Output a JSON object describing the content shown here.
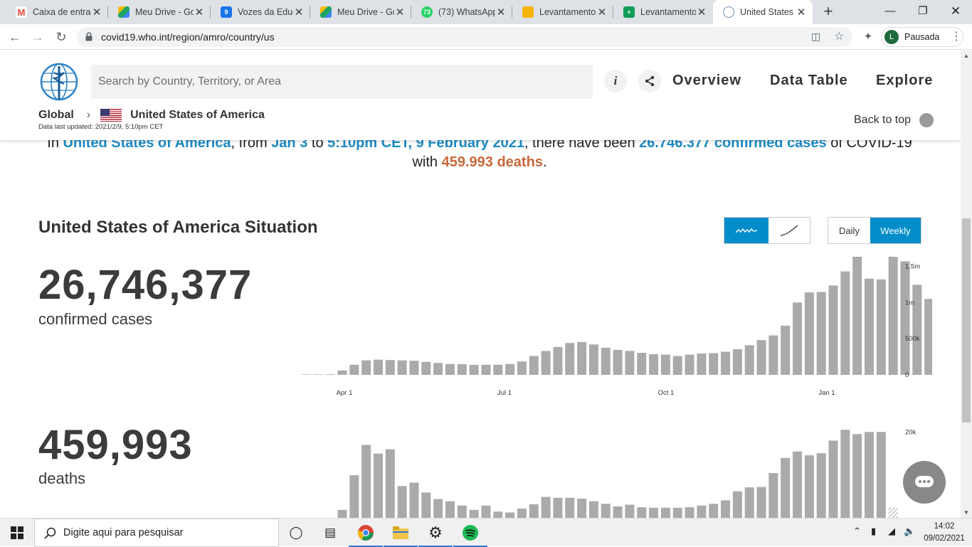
{
  "browser": {
    "tabs": [
      {
        "title": "Caixa de entrada",
        "icon": "gmail-icon",
        "color": "#ea4335"
      },
      {
        "title": "Meu Drive - Google Drive",
        "icon": "drive-icon",
        "color": "#1fa463"
      },
      {
        "title": "Vozes da Educação",
        "icon": "calendar-icon",
        "color": "#1a73e8"
      },
      {
        "title": "Meu Drive - Google Drive",
        "icon": "drive-icon",
        "color": "#1fa463"
      },
      {
        "title": "(73) WhatsApp",
        "icon": "whatsapp-icon",
        "color": "#25d366"
      },
      {
        "title": "Levantamento",
        "icon": "slides-icon",
        "color": "#f4b400"
      },
      {
        "title": "Levantamento",
        "icon": "sheets-icon",
        "color": "#0f9d58"
      },
      {
        "title": "United States of America",
        "icon": "who-icon",
        "color": "#009ada"
      }
    ],
    "url": "covid19.who.int/region/amro/country/us",
    "profile_initial": "L",
    "profile_label": "Pausada"
  },
  "header": {
    "search_placeholder": "Search by Country, Territory, or Area",
    "nav": [
      "Overview",
      "Data Table",
      "Explore"
    ],
    "info_glyph": "i",
    "breadcrumb_global": "Global",
    "breadcrumb_country": "United States of America",
    "updated": "Data last updated: 2021/2/9, 5:10pm CET",
    "back_to_top": "Back to top"
  },
  "summary": {
    "p1": "In ",
    "country": "United States of America",
    "p2": ", from ",
    "start": "Jan 3",
    "p3": " to ",
    "end": "5:10pm CET, 9 February 2021",
    "p4": ", there have been ",
    "cases": "26.746.377 confirmed cases",
    "p5": " of COVID-19 with ",
    "deaths": "459.993 deaths",
    "p6": "."
  },
  "situation": {
    "title": "United States of America Situation",
    "toggle_daily": "Daily",
    "toggle_weekly": "Weekly",
    "cases_total": "26,746,377",
    "cases_label": "confirmed cases",
    "deaths_total": "459,993",
    "deaths_label": "deaths"
  },
  "chart_data": [
    {
      "type": "bar",
      "title": "confirmed cases",
      "x_ticks": [
        "Jan 1",
        "Apr 1",
        "Jul 1",
        "Oct 1",
        "Jan 1"
      ],
      "y_ticks": [
        "1.5m",
        "1m",
        "500k",
        "0"
      ],
      "ylim": [
        0,
        1750000
      ],
      "values": [
        300,
        1000,
        8000,
        60000,
        140000,
        200000,
        210000,
        205000,
        200000,
        195000,
        180000,
        165000,
        150000,
        148000,
        138000,
        139000,
        140000,
        150000,
        185000,
        260000,
        330000,
        385000,
        440000,
        455000,
        420000,
        375000,
        345000,
        330000,
        305000,
        285000,
        280000,
        260000,
        280000,
        295000,
        300000,
        320000,
        355000,
        410000,
        480000,
        545000,
        680000,
        1000000,
        1140000,
        1145000,
        1235000,
        1430000,
        1650000,
        1330000,
        1320000,
        1780000,
        1570000,
        1245000,
        1050000,
        870000
      ],
      "grid": false,
      "legend": "none"
    },
    {
      "type": "bar",
      "title": "deaths",
      "y_ticks": [
        "20k"
      ],
      "ylim": [
        0,
        23000
      ],
      "values": [
        0,
        0,
        0,
        2000,
        10000,
        17000,
        15000,
        16000,
        7500,
        8300,
        6000,
        4500,
        4000,
        3000,
        2000,
        3000,
        1600,
        1400,
        2300,
        3300,
        5000,
        4800,
        4800,
        4600,
        4000,
        3400,
        2800,
        3200,
        2600,
        2500,
        2500,
        2500,
        2600,
        3000,
        3400,
        4200,
        6300,
        7200,
        7300,
        10500,
        14000,
        15500,
        14600,
        15100,
        18000,
        20500,
        19500,
        20000,
        20000
      ]
    }
  ],
  "taskbar": {
    "search_placeholder": "Digite aqui para pesquisar",
    "time": "14:02",
    "date": "09/02/2021"
  }
}
